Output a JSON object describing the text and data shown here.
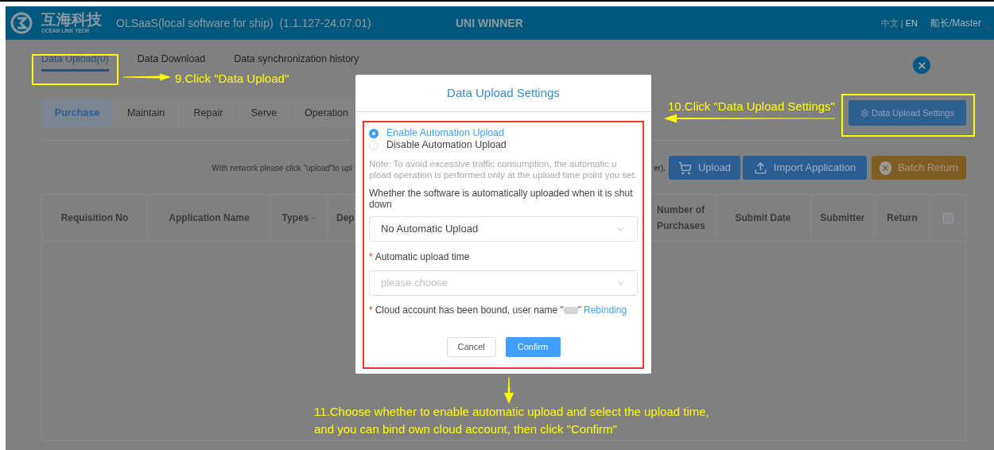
{
  "header": {
    "logo_name": "互海科技",
    "logo_sub": "OCEAN LINK TECH",
    "app_title": "OLSaaS(local software for ship)  (1.1.127-24.07.01)",
    "ship": "UNI WINNER",
    "languages": [
      {
        "label": "中文",
        "selected": false
      },
      {
        "label": "EN",
        "selected": true
      }
    ],
    "language_separator": "|",
    "user": "船长/Master"
  },
  "page_tabs": [
    {
      "label": "Data Upload(0)",
      "selected": true
    },
    {
      "label": "Data Download",
      "selected": false
    },
    {
      "label": "Data synchronization history",
      "selected": false
    }
  ],
  "module_tabs": [
    {
      "label": "Purchase",
      "selected": true
    },
    {
      "label": "Maintain",
      "selected": false
    },
    {
      "label": "Repair",
      "selected": false
    },
    {
      "label": "Serve",
      "selected": false
    },
    {
      "label": "Operation",
      "selected": false
    }
  ],
  "settings_button": "Data Upload Settings",
  "hint_left": "With network please click \"upload\"to upl",
  "hint_right": "er).",
  "actions": [
    {
      "label": "Upload",
      "kind": "upload"
    },
    {
      "label": "Import Application",
      "kind": "import"
    },
    {
      "label": "Batch Return",
      "kind": "return"
    }
  ],
  "table": {
    "columns_left": [
      "Requisition No",
      "Application Name",
      "Types",
      "Dep"
    ],
    "columns_right": [
      "Number of Purchases",
      "Submit Date",
      "Submitter",
      "Return"
    ],
    "select_all": {
      "checked": false
    }
  },
  "dialog": {
    "title": "Data Upload Settings",
    "options": [
      {
        "label": "Enable Automation Upload",
        "selected": true
      },
      {
        "label": "Disable Automation Upload",
        "selected": false
      }
    ],
    "note": "Note: To avoid excessive traffic consumption, the automatic u pload operation is performed only at the upload time point you set.",
    "shutdown_question": "Whether the software is automatically uploaded when it is shut down",
    "shutdown_value": "No Automatic Upload",
    "required_mark": "*",
    "time_label": "Automatic upload time",
    "time_placeholder": "please choose",
    "account_text": "Cloud account has been bound, user name \"",
    "account_end": "\"",
    "rebind_link": "Rebinding",
    "buttons": [
      {
        "label": "Cancel",
        "kind": "secondary"
      },
      {
        "label": "Confirm",
        "kind": "primary"
      }
    ]
  },
  "annotations": {
    "step_9": "9.Click \"Data Upload\"",
    "step_10": "10.Click \"Data Upload Settings\"",
    "step_11": "11.Choose whether to enable automatic upload and select the upload time,\nand you can bind own cloud account, then click \"Confirm\""
  }
}
